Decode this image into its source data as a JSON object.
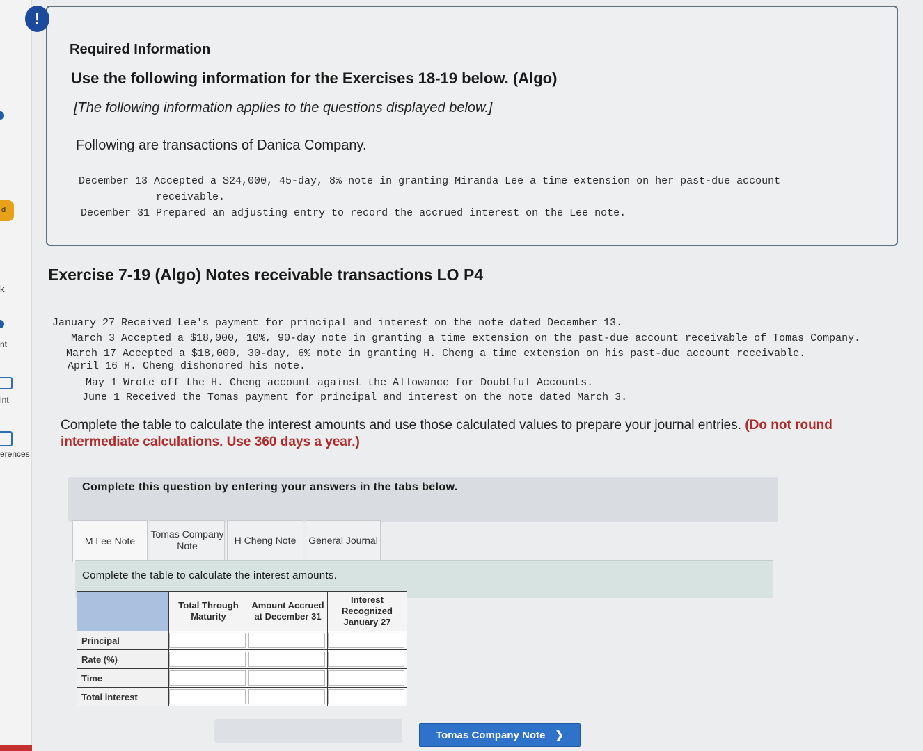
{
  "sidebar": {
    "fragments": [
      {
        "text": "k",
        "top": 0
      },
      {
        "text": "nt",
        "top": 0
      },
      {
        "text": "int",
        "top": 0
      },
      {
        "text": "erences",
        "top": 0
      }
    ],
    "badge": "d"
  },
  "info": {
    "alert": "!",
    "required": "Required Information",
    "use": "Use the following information for the Exercises 18-19 below. (Algo)",
    "applies": "[The following information applies to the questions displayed below.]",
    "following": "Following are transactions of Danica Company.",
    "line1": "December 13 Accepted a $24,000, 45-day, 8% note in granting Miranda Lee a time extension on her past-due account",
    "line1b": "receivable.",
    "line2": "December 31 Prepared an adjusting entry to record the accrued interest on the Lee note."
  },
  "exercise": {
    "title": "Exercise 7-19 (Algo) Notes receivable transactions LO P4",
    "transactions": [
      "January 27 Received Lee's payment for principal and interest on the note dated December 13.",
      "March 3 Accepted a $18,000, 10%, 90-day note in granting a time extension on the past-due account receivable of Tomas Company.",
      "March 17 Accepted a $18,000, 30-day, 6% note in granting H. Cheng a time extension on his past-due account receivable.",
      "April 16 H. Cheng dishonored his note.",
      "May 1 Wrote off the H. Cheng account against the Allowance for Doubtful Accounts.",
      "June 1 Received the Tomas payment for principal and interest on the note dated March 3."
    ]
  },
  "instruction": {
    "text": "Complete the table to calculate the interest amounts and use those calculated values to prepare your journal entries.",
    "red": "(Do not round intermediate calculations. Use 360 days a year.)"
  },
  "question_bar": "Complete this question by entering your answers in the tabs below.",
  "tabs": [
    {
      "label": "M Lee Note"
    },
    {
      "label": "Tomas Company Note"
    },
    {
      "label": "H Cheng Note"
    },
    {
      "label": "General Journal"
    }
  ],
  "tab_instruction": "Complete the table to calculate the interest amounts.",
  "table": {
    "columns": [
      "Total Through Maturity",
      "Amount Accrued at December 31",
      "Interest Recognized January 27"
    ],
    "rows": [
      "Principal",
      "Rate (%)",
      "Time",
      "Total interest"
    ]
  },
  "next_button": "Tomas Company Note",
  "colors": {
    "alert": "#1d4b9b",
    "button": "#2f72c9",
    "red_text": "#b22a2a"
  }
}
